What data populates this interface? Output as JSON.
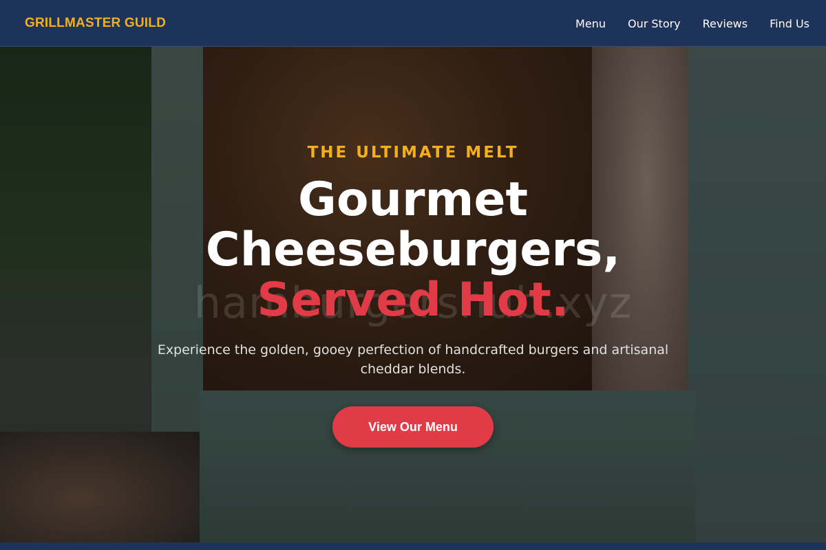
{
  "brand": "GRILLMASTER GUILD",
  "nav": [
    "Menu",
    "Our Story",
    "Reviews",
    "Find Us"
  ],
  "hero": {
    "eyebrow": "THE ULTIMATE MELT",
    "headline_line1": "Gourmet",
    "headline_line2": "Cheeseburgers,",
    "headline_line3": "Served Hot.",
    "subtext": "Experience the golden, gooey perfection of handcrafted burgers and artisanal cheddar blends.",
    "cta": "View Our Menu",
    "watermark": "hamburgershub.xyz"
  },
  "colors": {
    "navbar": "#1e3359",
    "brand_accent": "#f3b01c",
    "red_accent": "#e23b48"
  }
}
